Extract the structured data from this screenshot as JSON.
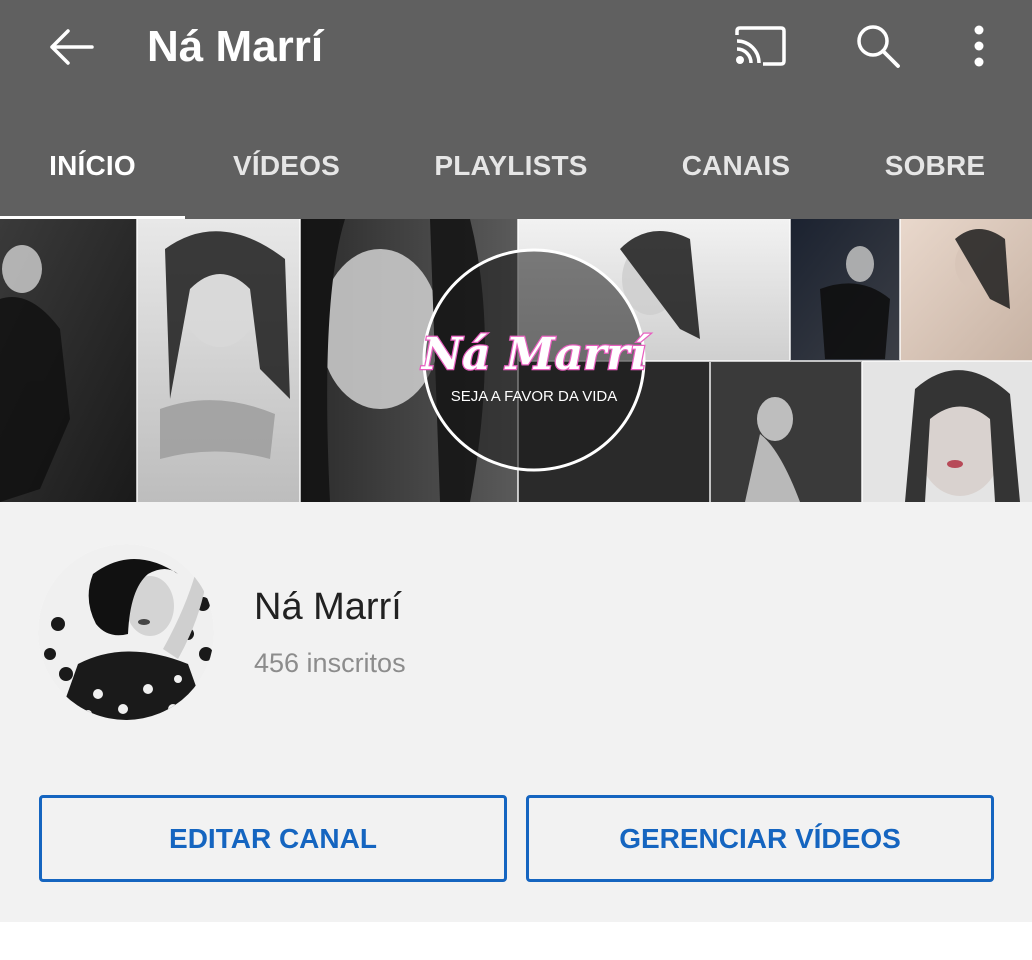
{
  "appbar": {
    "back_icon": "arrow-back-icon",
    "title": "Ná Marrí",
    "cast_icon": "cast-icon",
    "search_icon": "search-icon",
    "more_icon": "more-vert-icon"
  },
  "tabs": [
    {
      "label": "INÍCIO",
      "active": true
    },
    {
      "label": "VÍDEOS",
      "active": false
    },
    {
      "label": "PLAYLISTS",
      "active": false
    },
    {
      "label": "CANAIS",
      "active": false
    },
    {
      "label": "SOBRE",
      "active": false
    }
  ],
  "banner": {
    "logo_text": "Ná Marrí",
    "tagline": "SEJA A FAVOR DA VIDA"
  },
  "channel": {
    "name": "Ná Marrí",
    "subscribers": "456 inscritos"
  },
  "actions": {
    "edit_label": "EDITAR CANAL",
    "manage_label": "GERENCIAR VÍDEOS"
  },
  "colors": {
    "appbar": "#606060",
    "accent": "#1565c0",
    "logo_pink": "#e85fc0",
    "background": "#f2f2f2"
  }
}
